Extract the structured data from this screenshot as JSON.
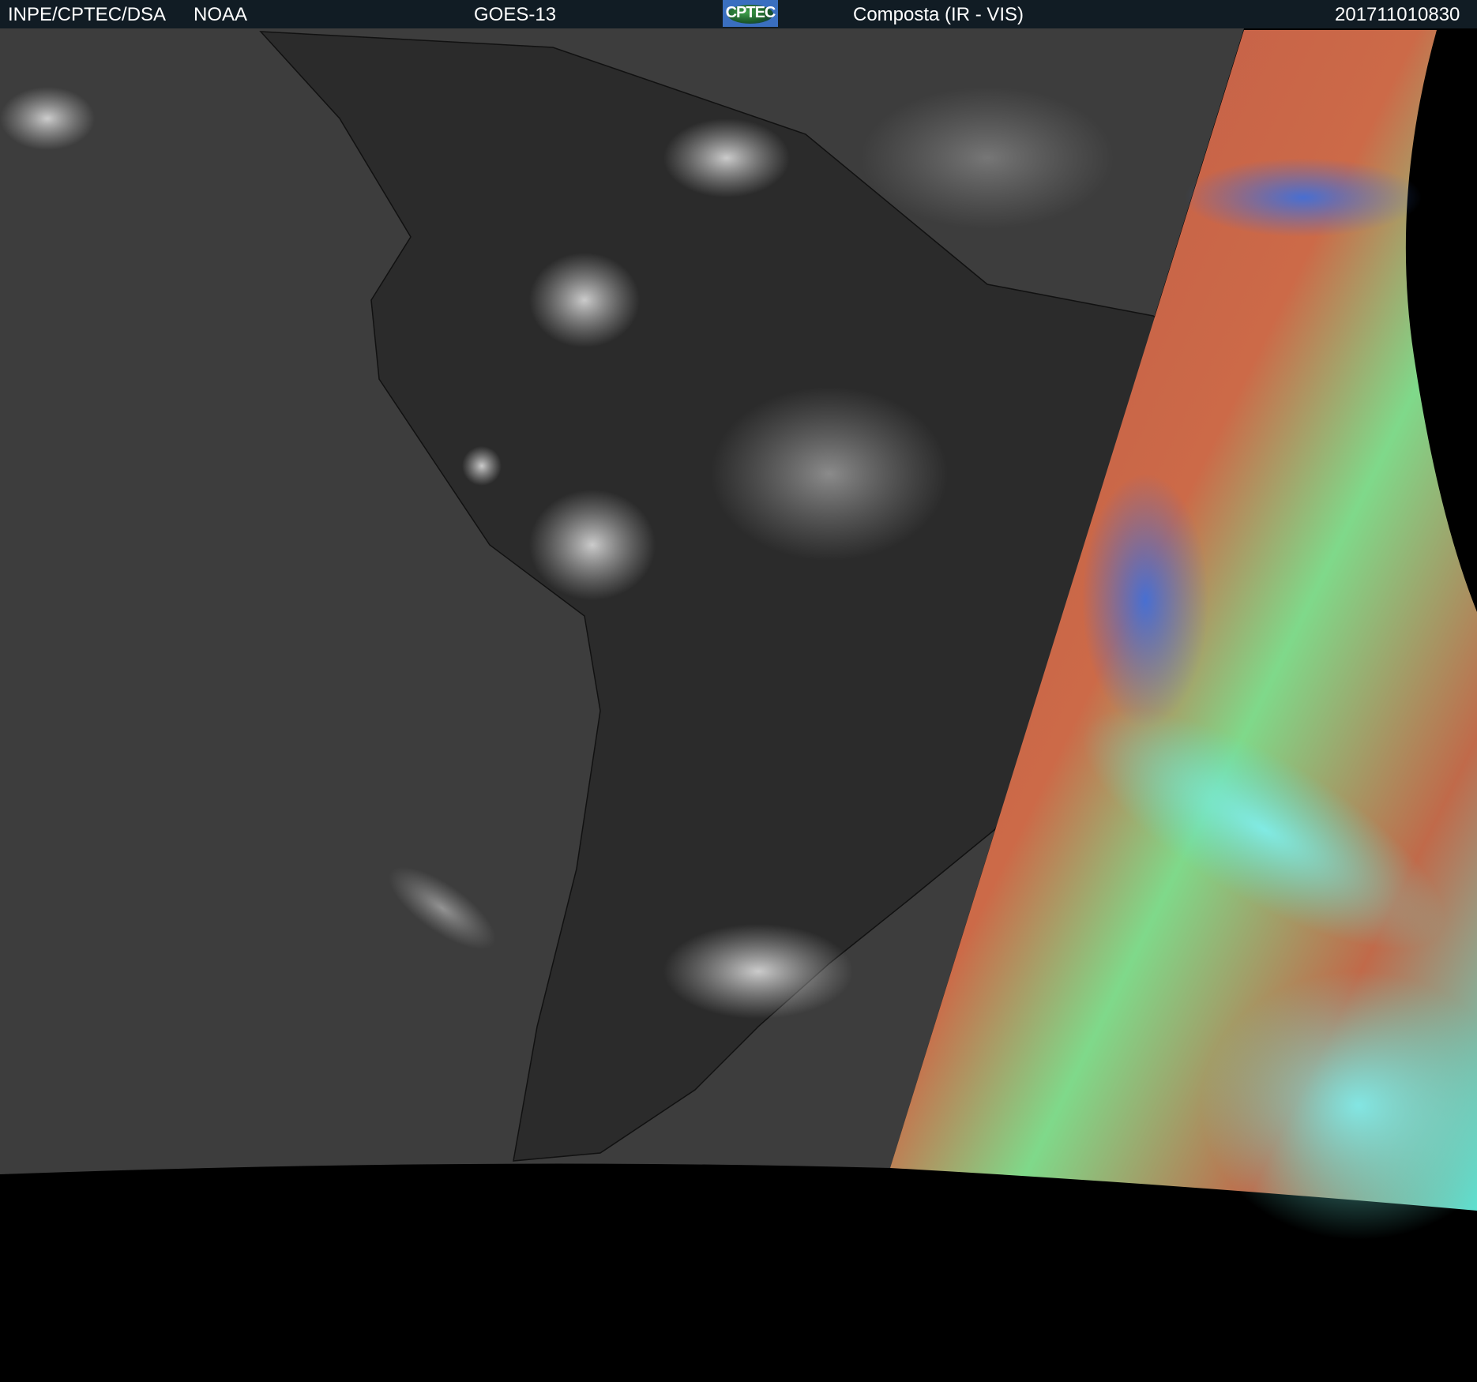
{
  "header": {
    "institution": "INPE/CPTEC/DSA",
    "agency": "NOAA",
    "satellite": "GOES-13",
    "logo_text": "CPTEC",
    "product": "Composta (IR - VIS)",
    "timestamp": "201711010830"
  },
  "colors": {
    "header_bg": "#111c24",
    "ocean_ir": "#3c3c3c",
    "land_ir": "#2a2a2a"
  }
}
